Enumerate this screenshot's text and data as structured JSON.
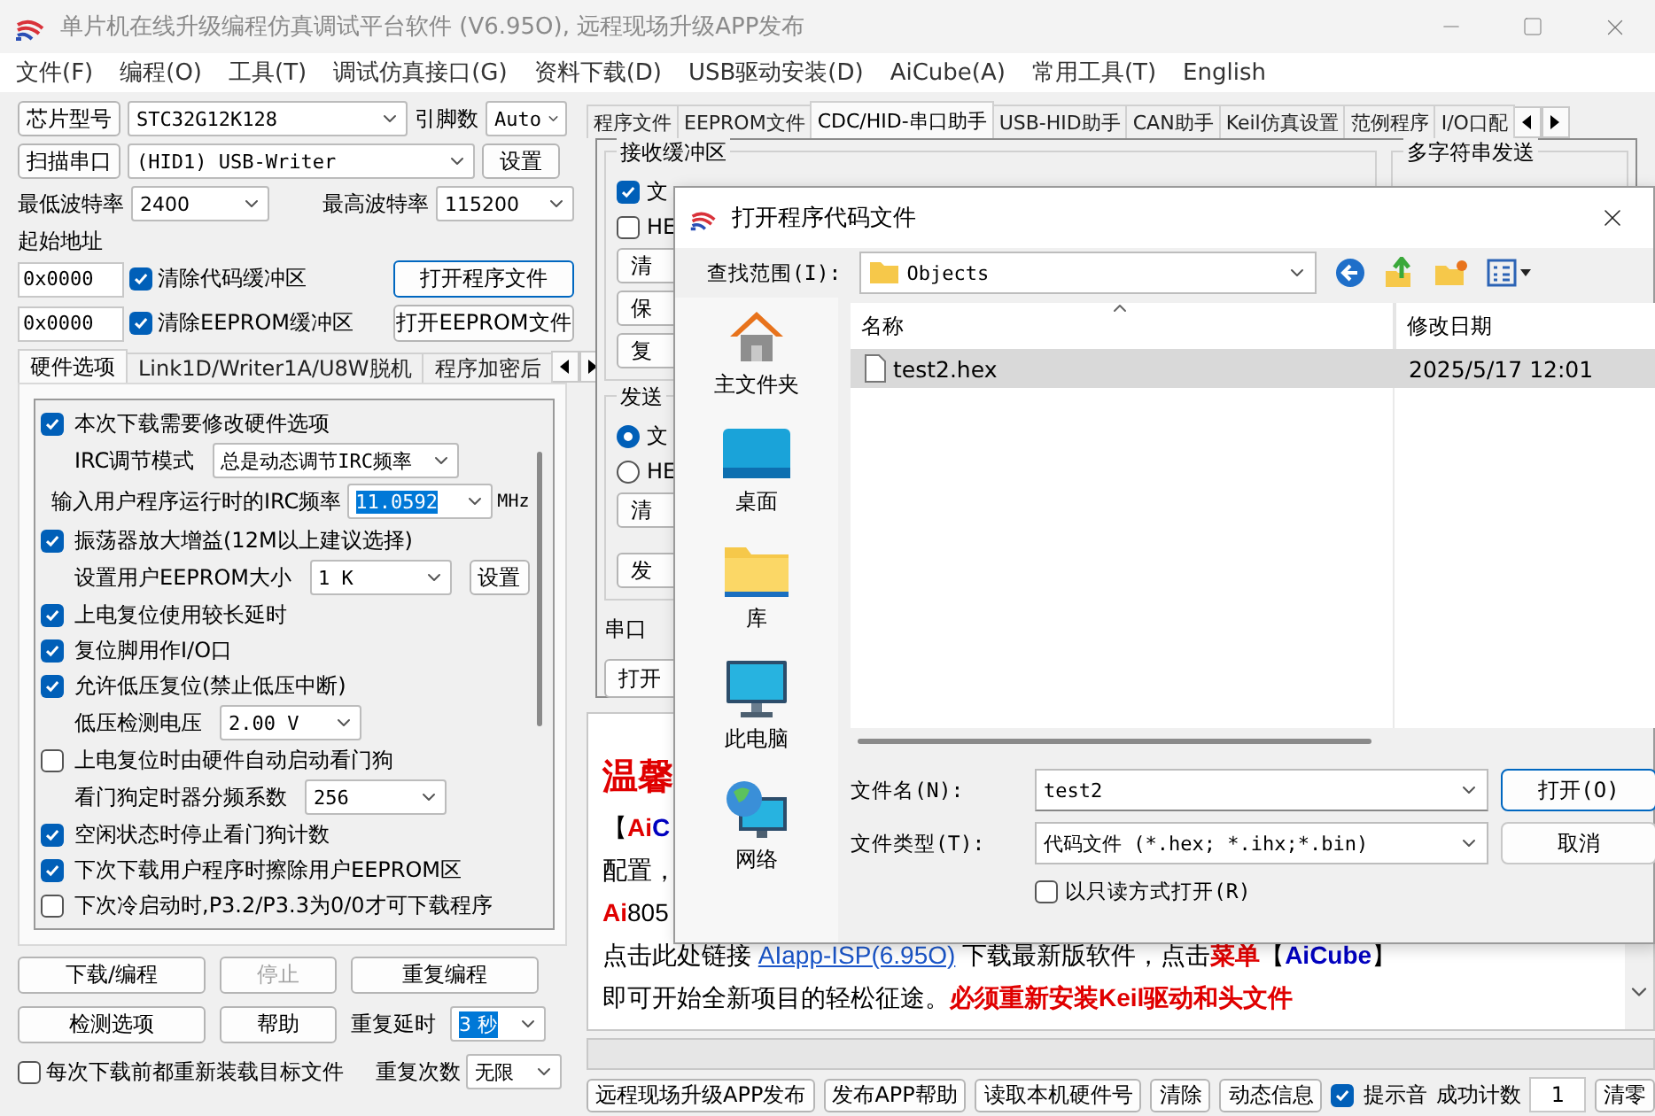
{
  "window": {
    "title": "单片机在线升级编程仿真调试平台软件 (V6.95O), 远程现场升级APP发布"
  },
  "menu": [
    "文件(F)",
    "编程(O)",
    "工具(T)",
    "调试仿真接口(G)",
    "资料下载(D)",
    "USB驱动安装(D)",
    "AiCube(A)",
    "常用工具(T)",
    "English"
  ],
  "left": {
    "chip": {
      "button": "芯片型号",
      "value": "STC32G12K128",
      "pins_label": "引脚数",
      "pins": "Auto"
    },
    "port": {
      "button": "扫描串口",
      "value": "(HID1) USB-Writer",
      "settings": "设置"
    },
    "baud": {
      "min_label": "最低波特率",
      "min": "2400",
      "max_label": "最高波特率",
      "max": "115200"
    },
    "address": {
      "label": "起始地址",
      "rows": [
        {
          "value": "0x0000",
          "checkbox": "清除代码缓冲区",
          "checked": true,
          "button": "打开程序文件",
          "focused": true
        },
        {
          "value": "0x0000",
          "checkbox": "清除EEPROM缓冲区",
          "checked": true,
          "button": "打开EEPROM文件",
          "focused": false
        }
      ]
    },
    "tabs": [
      {
        "label": "硬件选项",
        "selected": true
      },
      {
        "label": "Link1D/Writer1A/U8W脱机",
        "selected": false
      },
      {
        "label": "程序加密后",
        "selected": false
      }
    ],
    "options": [
      {
        "kind": "checkbox",
        "label": "本次下载需要修改硬件选项",
        "checked": true
      },
      {
        "kind": "select",
        "label": "IRC调节模式",
        "value": "总是动态调节IRC频率"
      },
      {
        "kind": "frequency",
        "label": "输入用户程序运行时的IRC频率",
        "value": "11.0592",
        "unit": "MHz"
      },
      {
        "kind": "checkbox",
        "label": "振荡器放大增益(12M以上建议选择)",
        "checked": true
      },
      {
        "kind": "select",
        "label": "设置用户EEPROM大小",
        "value": "1   K",
        "button": "设置"
      },
      {
        "kind": "checkbox",
        "label": "上电复位使用较长延时",
        "checked": true
      },
      {
        "kind": "checkbox",
        "label": "复位脚用作I/O口",
        "checked": true
      },
      {
        "kind": "checkbox",
        "label": "允许低压复位(禁止低压中断)",
        "checked": true
      },
      {
        "kind": "select",
        "label": "低压检测电压",
        "value": "2.00 V"
      },
      {
        "kind": "checkbox",
        "label": "上电复位时由硬件自动启动看门狗",
        "checked": false
      },
      {
        "kind": "select",
        "label": "看门狗定时器分频系数",
        "value": "256"
      },
      {
        "kind": "checkbox",
        "label": "空闲状态时停止看门狗计数",
        "checked": true
      },
      {
        "kind": "checkbox",
        "label": "下次下载用户程序时擦除用户EEPROM区",
        "checked": true
      },
      {
        "kind": "checkbox",
        "label": "下次冷启动时,P3.2/P3.3为0/0才可下载程序",
        "checked": false
      }
    ],
    "actions": [
      {
        "label": "下载/编程",
        "disabled": false
      },
      {
        "label": "停止",
        "disabled": true
      },
      {
        "label": "重复编程",
        "disabled": false
      },
      {
        "label": "检测选项",
        "disabled": false
      },
      {
        "label": "帮助",
        "disabled": false
      }
    ],
    "repeat_delay": {
      "label": "重复延时",
      "value": "3 秒"
    },
    "reload": {
      "label": "每次下载前都重新装载目标文件",
      "checked": false
    },
    "repeat_count": {
      "label": "重复次数",
      "value": "无限"
    }
  },
  "right": {
    "tabs": [
      {
        "label": "程序文件",
        "selected": false
      },
      {
        "label": "EEPROM文件",
        "selected": false
      },
      {
        "label": "CDC/HID-串口助手",
        "selected": true
      },
      {
        "label": "USB-HID助手",
        "selected": false
      },
      {
        "label": "CAN助手",
        "selected": false
      },
      {
        "label": "Keil仿真设置",
        "selected": false
      },
      {
        "label": "范例程序",
        "selected": false
      },
      {
        "label": "I/O口配",
        "selected": false
      }
    ],
    "receive": {
      "title": "接收缓冲区",
      "modes": [
        {
          "label": "文",
          "checked": true
        },
        {
          "label": "HE",
          "checked": false
        }
      ],
      "buttons": [
        "清",
        "保",
        "复"
      ]
    },
    "send": {
      "title": "发送",
      "modes": [
        {
          "label": "文",
          "selected": true
        },
        {
          "label": "HE",
          "selected": false
        }
      ],
      "buttons": [
        "清",
        "发"
      ]
    },
    "port_label": "串口",
    "open_button": "打开",
    "multi_send": {
      "title": "多字符串发送"
    },
    "notice": [
      {
        "kind": "heading",
        "segments": [
          {
            "text": "温馨",
            "color": "#e00000",
            "bold": true
          }
        ]
      },
      {
        "kind": "line",
        "segments": [
          {
            "text": "【",
            "color": "#000000",
            "bold": false
          },
          {
            "text": "Ai",
            "color": "#e00000",
            "bold": true
          },
          {
            "text": "C",
            "color": "#0000c0",
            "bold": true
          }
        ]
      },
      {
        "kind": "line",
        "segments": [
          {
            "text": "配置，",
            "color": "#000000",
            "bold": false
          }
        ]
      },
      {
        "kind": "line",
        "segments": [
          {
            "text": "Ai",
            "color": "#e00000",
            "bold": true
          },
          {
            "text": "805",
            "color": "#000000",
            "bold": false
          }
        ]
      },
      {
        "kind": "line",
        "segments": [
          {
            "text": "点击此处链接 ",
            "color": "#000000",
            "bold": false
          },
          {
            "text": "AIapp-ISP(6.95O)",
            "color": "#1a55c8",
            "bold": false,
            "link": true
          },
          {
            "text": " 下载最新版软件，点击",
            "color": "#000000",
            "bold": false
          },
          {
            "text": "菜单",
            "color": "#e00000",
            "bold": true
          },
          {
            "text": "【",
            "color": "#000000",
            "bold": false
          },
          {
            "text": "AiCube",
            "color": "#0000c0",
            "bold": true
          },
          {
            "text": "】",
            "color": "#000000",
            "bold": false
          }
        ]
      },
      {
        "kind": "line",
        "segments": [
          {
            "text": "即可开始全新项目的轻松征途。",
            "color": "#000000",
            "bold": false
          },
          {
            "text": "必须重新安装Keil驱动和头文件",
            "color": "#e00000",
            "bold": true
          }
        ]
      }
    ],
    "progress": {
      "level": 0
    },
    "bottom": {
      "buttons": [
        "远程现场升级APP发布",
        "发布APP帮助",
        "读取本机硬件号",
        "清除",
        "动态信息"
      ],
      "beep": {
        "label": "提示音",
        "checked": true
      },
      "count_label": "成功计数",
      "count": "1",
      "reset": "清零"
    }
  },
  "dialog": {
    "title": "打开程序代码文件",
    "look_in_label": "查找范围(I):",
    "look_in": "Objects",
    "places": [
      {
        "label": "主文件夹",
        "kind": "home"
      },
      {
        "label": "桌面",
        "kind": "desktop"
      },
      {
        "label": "库",
        "kind": "library"
      },
      {
        "label": "此电脑",
        "kind": "computer"
      },
      {
        "label": "网络",
        "kind": "network"
      }
    ],
    "columns": [
      "名称",
      "修改日期"
    ],
    "files": [
      {
        "name": "test2.hex",
        "date": "2025/5/17 12:01",
        "selected": true
      }
    ],
    "file_name_label": "文件名(N):",
    "file_name": "test2",
    "file_type_label": "文件类型(T):",
    "file_type": "代码文件 (*.hex;  *.ihx;*.bin)",
    "open": "打开(O)",
    "cancel": "取消",
    "readonly": {
      "label": "以只读方式打开(R)",
      "checked": false
    }
  }
}
